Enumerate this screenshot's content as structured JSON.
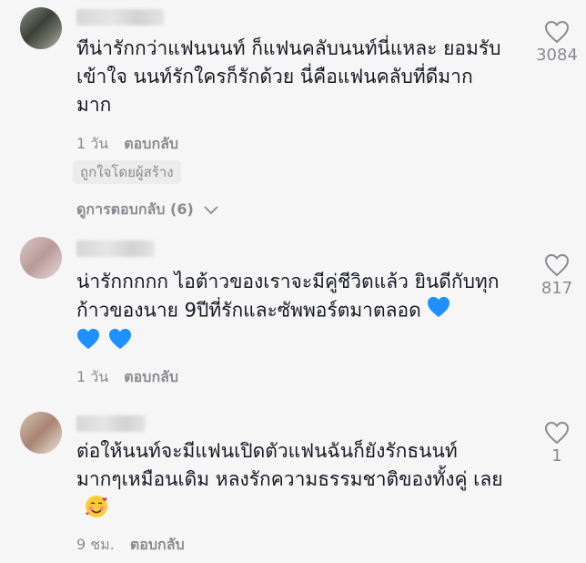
{
  "comments": [
    {
      "text": "ทีน่ารักกว่าแฟนนนท์ ก็แฟนคลับนนท์นี่แหละ ยอมรับ เข้าใจ นนท์รักใครก็รักด้วย นี่คือแฟนคลับที่ดีมากมาก",
      "time": "1 วัน",
      "reply_label": "ตอบกลับ",
      "badge": "ถูกใจโดยผู้สร้าง",
      "view_replies": "ดูการตอบกลับ (6)",
      "likes": "3084"
    },
    {
      "text": "น่ารักกกกก ไอต้าวของเราจะมีคู่ชีวิตแล้ว ยินดีกับทุกก้าวของนาย 9ปีที่รักและซัพพอร์ตมาตลอด",
      "time": "1 วัน",
      "reply_label": "ตอบกลับ",
      "likes": "817",
      "emoji": "blue-heart"
    },
    {
      "text": "ต่อให้นนท์จะมีแฟนเปิดตัวแฟนฉันก็ยังรักธนนท์ มากๆเหมือนเดิม หลงรักความธรรมชาติของทั้งคู่ เลย",
      "time": "9 ชม.",
      "reply_label": "ตอบกลับ",
      "likes": "1",
      "emoji": "smiling-face-with-hearts"
    }
  ],
  "colors": {
    "background": "#f6f6f6",
    "text": "#161823",
    "secondary": "#8a8b91",
    "blue_heart": "#1e90ff"
  }
}
